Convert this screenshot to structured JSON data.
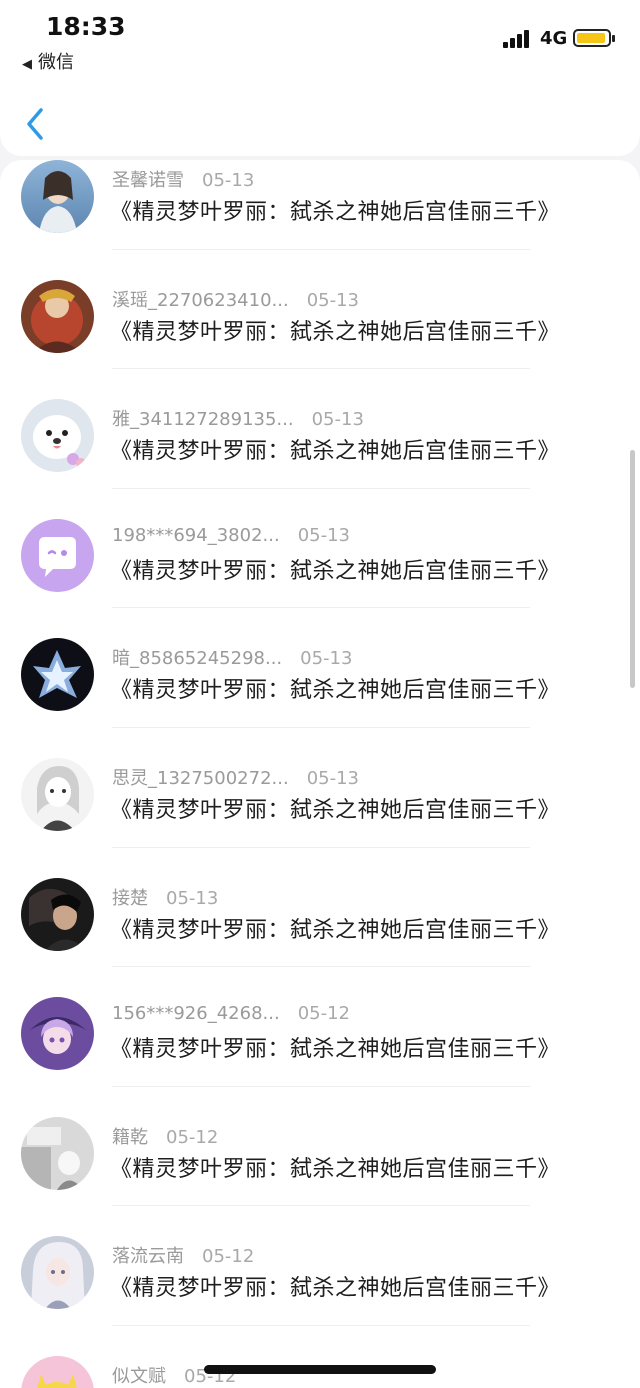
{
  "status": {
    "time": "18:33",
    "back_app": "微信",
    "network": "4G"
  },
  "colors": {
    "accent": "#2f9be6",
    "battery": "#f5c518"
  },
  "icons": {
    "back": "chevron-left-icon"
  },
  "items": [
    {
      "name": "圣馨诺雪",
      "date": "05-13",
      "message": "《精灵梦叶罗丽：弑杀之神她后宫佳丽三千》"
    },
    {
      "name": "溪瑶_2270623410...",
      "date": "05-13",
      "message": "《精灵梦叶罗丽：弑杀之神她后宫佳丽三千》"
    },
    {
      "name": "雅_341127289135...",
      "date": "05-13",
      "message": "《精灵梦叶罗丽：弑杀之神她后宫佳丽三千》"
    },
    {
      "name": "198***694_3802...",
      "date": "05-13",
      "message": "《精灵梦叶罗丽：弑杀之神她后宫佳丽三千》"
    },
    {
      "name": "暗_85865245298...",
      "date": "05-13",
      "message": "《精灵梦叶罗丽：弑杀之神她后宫佳丽三千》"
    },
    {
      "name": "思灵_1327500272...",
      "date": "05-13",
      "message": "《精灵梦叶罗丽：弑杀之神她后宫佳丽三千》"
    },
    {
      "name": "接楚",
      "date": "05-13",
      "message": "《精灵梦叶罗丽：弑杀之神她后宫佳丽三千》"
    },
    {
      "name": "156***926_4268...",
      "date": "05-12",
      "message": "《精灵梦叶罗丽：弑杀之神她后宫佳丽三千》"
    },
    {
      "name": "籍乾",
      "date": "05-12",
      "message": "《精灵梦叶罗丽：弑杀之神她后宫佳丽三千》"
    },
    {
      "name": "落流云南",
      "date": "05-12",
      "message": "《精灵梦叶罗丽：弑杀之神她后宫佳丽三千》"
    },
    {
      "name": "似文赋",
      "date": "05-12",
      "message": ""
    }
  ]
}
